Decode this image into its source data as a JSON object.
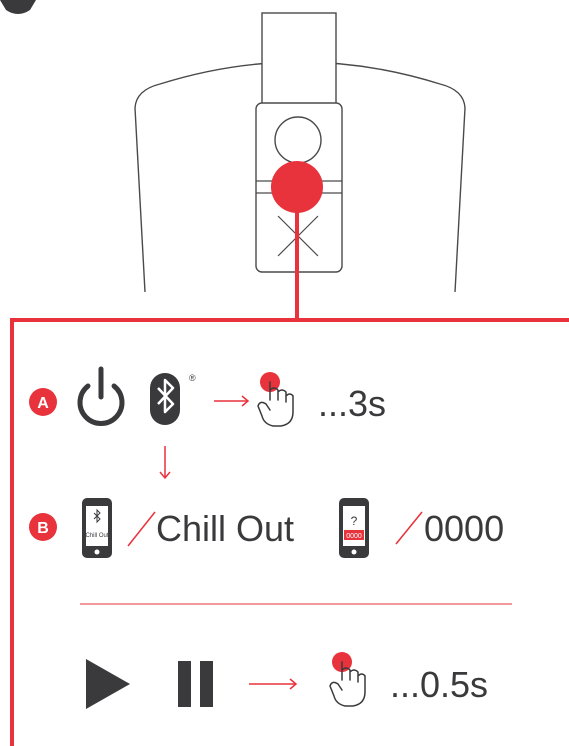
{
  "colors": {
    "accent_red": "#e8323c",
    "ink_dark": "#3a3a3c",
    "outline_grey": "#4a4a4a"
  },
  "device": {
    "top_icon": "lightbulb-icon"
  },
  "step_a": {
    "badge": "A",
    "icons": [
      "power-icon",
      "bluetooth-icon",
      "registered-mark-icon",
      "arrow-right-icon",
      "press-hand-icon"
    ],
    "registered_mark": "®",
    "duration": "...3s"
  },
  "step_b": {
    "badge": "B",
    "phone1_text": "Chill Out",
    "device_name": "Chill Out",
    "phone2_question": "?",
    "phone2_code": "0000",
    "pin": "0000"
  },
  "play_pause": {
    "icons": [
      "play-icon",
      "pause-icon",
      "arrow-right-icon",
      "press-hand-icon"
    ],
    "duration": "...0.5s"
  }
}
